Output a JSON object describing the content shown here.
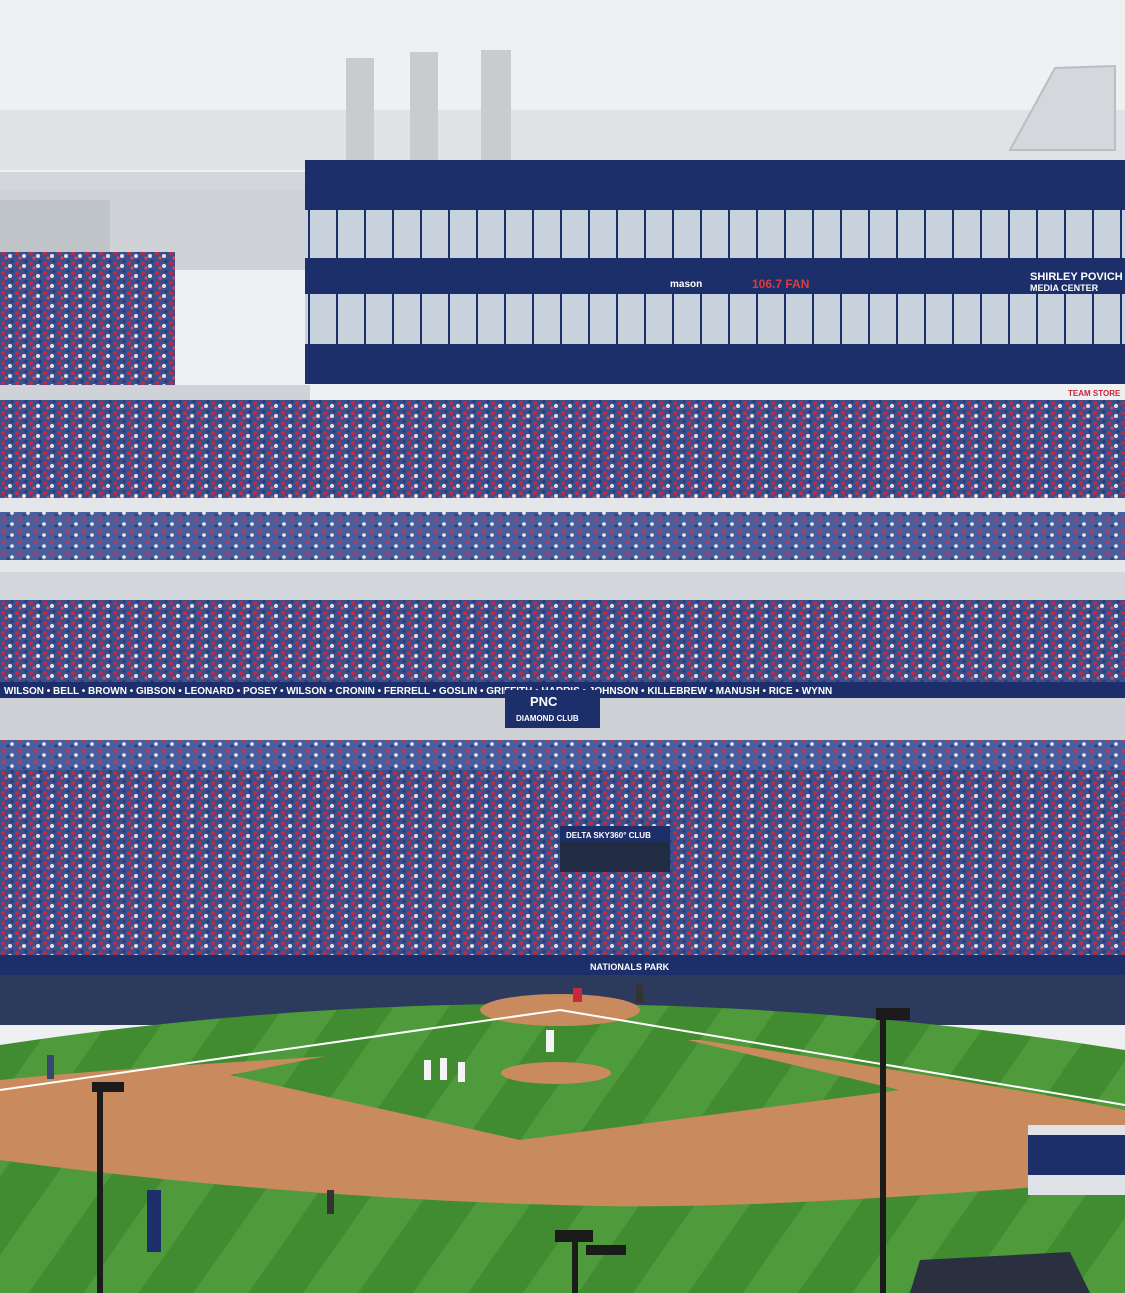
{
  "signage": {
    "media_center_line1": "SHIRLEY POVICH",
    "media_center_line2": "MEDIA CENTER",
    "radio_sign": "106.7 FAN",
    "mason_sign": "mason",
    "diamond_club_brand": "PNC",
    "diamond_club_label": "DIAMOND CLUB",
    "sky_club_label": "DELTA SKY360° CLUB",
    "wall_sign": "NATIONALS PARK",
    "team_store": "TEAM STORE",
    "ring_of_honor": [
      "WILSON",
      "BELL",
      "BROWN",
      "GIBSON",
      "LEONARD",
      "POSEY",
      "WILSON",
      "CRONIN",
      "FERRELL",
      "GOSLIN",
      "GRIFFITH",
      "HARRIS",
      "JOHNSON",
      "KILLEBREW",
      "MANUSH",
      "RICE",
      "WYNN"
    ]
  },
  "colors": {
    "sky": "#eef0f2",
    "navy": "#1d2f6b",
    "seat_blue": "#3b4f8f",
    "crowd_red": "#c8283a",
    "grass_light": "#4f9a3a",
    "grass_dark": "#3f8a30",
    "dirt": "#c98a5e",
    "concrete": "#d9dbe0"
  }
}
